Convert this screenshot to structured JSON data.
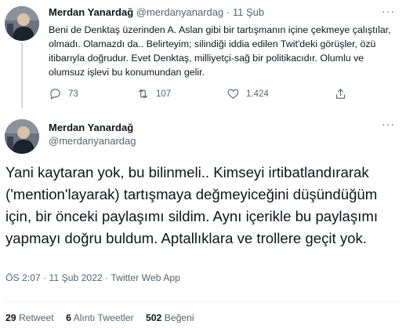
{
  "tweet1": {
    "author_name": "Merdan Yanardağ",
    "handle": "@merdanyanardag",
    "separator": "·",
    "date": "11 Şub",
    "more": "···",
    "text": "Beni de Denktaş üzerinden A. Aslan gibi bir tartışmanın içine çekmeye çalıştılar, olmadı. Olamazdı da.. Belirteyim; silindiği iddia edilen Twit'deki görüşler, özü itibarıyla doğrudur. Evet Denktaş, milliyetçi-sağ bir politikacıdır. Olumlu ve olumsuz işlevi bu konumundan gelir.",
    "actions": {
      "reply_count": "73",
      "retweet_count": "107",
      "like_count": "1.424"
    },
    "icons": [
      "reply-icon",
      "retweet-icon",
      "like-icon",
      "share-icon"
    ]
  },
  "tweet2": {
    "author_name": "Merdan Yanardağ",
    "handle": "@merdanyanardag",
    "more": "···",
    "text": "Yani kaytaran yok, bu bilinmeli.. Kimseyi irtibatlandırarak ('mention'layarak) tartışmaya değmeyiceğini düşündüğüm için, bir önceki paylaşımı sildim. Aynı içerikle bu paylaşımı yapmayı doğru buldum. Aptallıklara ve trollere geçit yok.",
    "meta": "ÖS 2:07 · 11 Şub 2022 · Twitter Web App",
    "stats": {
      "retweets_count": "29",
      "retweets_label": "Retweet",
      "quotes_count": "6",
      "quotes_label": "Alıntı Tweetler",
      "likes_count": "502",
      "likes_label": "Beğeni"
    }
  },
  "colors": {
    "text": "#0f1419",
    "muted": "#536471",
    "divider": "#eff3f4",
    "thread_line": "#cfd9de"
  }
}
